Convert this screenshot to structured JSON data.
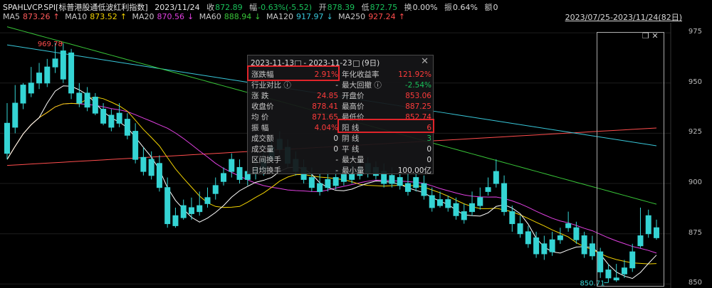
{
  "header": {
    "symbol": "SPAHLVCP.SPI[标普港股通低波红利指数]",
    "date": "2023/11/24",
    "close_label": "收",
    "close": "872.89",
    "pct_label": "幅",
    "pct": "-0.63%(-5.52)",
    "open_label": "开",
    "open": "878.39",
    "low_label": "低",
    "low": "872.75",
    "turnover_label": "换",
    "turnover": "0.00%",
    "amplitude_label": "振",
    "amplitude": "0.64%",
    "amount_label": "额",
    "amount": "0"
  },
  "ma": [
    {
      "name": "MA5",
      "value": "873.26",
      "arrow": "↑",
      "color": "#ffffff"
    },
    {
      "name": "MA10",
      "value": "873.52",
      "arrow": "↑",
      "color": "#f2d200"
    },
    {
      "name": "MA20",
      "value": "870.56",
      "arrow": "↓",
      "color": "#e040e0"
    },
    {
      "name": "MA60",
      "value": "888.94",
      "arrow": "↓",
      "color": "#38c538"
    },
    {
      "name": "MA120",
      "value": "917.97",
      "arrow": "↓",
      "color": "#38c6d8"
    },
    {
      "name": "MA250",
      "value": "927.24",
      "arrow": "↑",
      "color": "#ff4d4d"
    }
  ],
  "date_range": "2023/07/25-2023/11/24(82日)",
  "axis": {
    "ticks": [
      "975",
      "950",
      "925",
      "900",
      "875",
      "850"
    ],
    "high_label": "969.78",
    "low_label": "850.71"
  },
  "panel": {
    "start": "2023-11-13",
    "sep": "-",
    "end": "2023-11-23",
    "days": "(9日)",
    "close": "✕",
    "rows": [
      {
        "l1": "涨跌幅",
        "v1": "2.91%",
        "c1": "red",
        "l2": "年化收益率",
        "v2": "121.92%",
        "c2": "red"
      },
      {
        "l1": "行业对比 ⓘ",
        "v1": "-",
        "c1": "white",
        "l2": "最大回撤 ⓘ",
        "v2": "-2.54%",
        "c2": "green"
      },
      {
        "l1": "涨   跌",
        "v1": "24.85",
        "c1": "red",
        "l2": "开盘价",
        "v2": "853.06",
        "c2": "red"
      },
      {
        "l1": "收盘价",
        "v1": "878.41",
        "c1": "red",
        "l2": "最高价",
        "v2": "887.25",
        "c2": "red"
      },
      {
        "l1": "均   价",
        "v1": "871.65",
        "c1": "red",
        "l2": "最低价",
        "v2": "852.74",
        "c2": "red"
      },
      {
        "l1": "振   幅",
        "v1": "4.04%",
        "c1": "red",
        "l2": "阳   线",
        "v2": "6",
        "c2": "red"
      },
      {
        "l1": "成交额",
        "v1": "0",
        "c1": "white",
        "l2": "阴   线",
        "v2": "3",
        "c2": "green"
      },
      {
        "l1": "成交量",
        "v1": "0",
        "c1": "white",
        "l2": "平   线",
        "v2": "0",
        "c2": "white"
      },
      {
        "l1": "区间换手",
        "v1": "-",
        "c1": "white",
        "l2": "最大量",
        "v2": "0",
        "c2": "white"
      },
      {
        "l1": "日均换手",
        "v1": "-",
        "c1": "white",
        "l2": "最小量",
        "v2": "100.00亿",
        "c2": "white"
      }
    ]
  },
  "chart_data": {
    "type": "candlestick",
    "ylim": [
      848,
      980
    ],
    "candles": [
      [
        930,
        940,
        915,
        912
      ],
      [
        940,
        949,
        928,
        925
      ],
      [
        949,
        950,
        940,
        937
      ],
      [
        950,
        958,
        945,
        943
      ],
      [
        955,
        960,
        950,
        947
      ],
      [
        958,
        962,
        950,
        948
      ],
      [
        962,
        970,
        958,
        955
      ],
      [
        966,
        969.78,
        952,
        950
      ],
      [
        965,
        967,
        945,
        942
      ],
      [
        945,
        950,
        940,
        938
      ],
      [
        945,
        948,
        938,
        936
      ],
      [
        943,
        945,
        935,
        934
      ],
      [
        937,
        940,
        930,
        929
      ],
      [
        934,
        937,
        928,
        926
      ],
      [
        935,
        940,
        930,
        928
      ],
      [
        932,
        935,
        924,
        922
      ],
      [
        926,
        930,
        912,
        910
      ],
      [
        913,
        918,
        906,
        904
      ],
      [
        912,
        916,
        904,
        902
      ],
      [
        910,
        914,
        898,
        896
      ],
      [
        898,
        903,
        880,
        878
      ],
      [
        884,
        888,
        879,
        878
      ],
      [
        889,
        892,
        883,
        882
      ],
      [
        888,
        893,
        885,
        882
      ],
      [
        889,
        896,
        886,
        884
      ],
      [
        893,
        898,
        890,
        888
      ],
      [
        899,
        903,
        895,
        892
      ],
      [
        905,
        908,
        901,
        899
      ],
      [
        912,
        915,
        906,
        903
      ],
      [
        908,
        912,
        902,
        900
      ],
      [
        906,
        910,
        902,
        899
      ],
      [
        908,
        912,
        905,
        902
      ],
      [
        912,
        916,
        906,
        904
      ],
      [
        918,
        922,
        912,
        910
      ],
      [
        922,
        926,
        917,
        915
      ],
      [
        918,
        922,
        910,
        908
      ],
      [
        912,
        916,
        906,
        904
      ],
      [
        908,
        912,
        902,
        900
      ],
      [
        903,
        908,
        898,
        896
      ],
      [
        900,
        905,
        896,
        894
      ],
      [
        902,
        906,
        898,
        896
      ],
      [
        903,
        907,
        899,
        897
      ],
      [
        905,
        909,
        901,
        899
      ],
      [
        906,
        910,
        902,
        900
      ],
      [
        908,
        912,
        904,
        902
      ],
      [
        910,
        913,
        905,
        903
      ],
      [
        908,
        911,
        904,
        902
      ],
      [
        906,
        910,
        900,
        898
      ],
      [
        904,
        908,
        900,
        898
      ],
      [
        903,
        907,
        899,
        897
      ],
      [
        900,
        905,
        896,
        894
      ],
      [
        903,
        906,
        898,
        896
      ],
      [
        900,
        904,
        894,
        892
      ],
      [
        894,
        898,
        888,
        886
      ],
      [
        892,
        896,
        889,
        888
      ],
      [
        892,
        894,
        888,
        886
      ],
      [
        890,
        893,
        884,
        882
      ],
      [
        886,
        890,
        882,
        880
      ],
      [
        890,
        896,
        886,
        884
      ],
      [
        893,
        898,
        889,
        887
      ],
      [
        898,
        903,
        896,
        894
      ],
      [
        906,
        912,
        900,
        898
      ],
      [
        900,
        904,
        886,
        884
      ],
      [
        886,
        889,
        880,
        876
      ],
      [
        880,
        884,
        875,
        873
      ],
      [
        876,
        879,
        870,
        868
      ],
      [
        873,
        876,
        865,
        863
      ],
      [
        870,
        874,
        865,
        862
      ],
      [
        872,
        876,
        866,
        864
      ],
      [
        874,
        878,
        872,
        870
      ],
      [
        880,
        886,
        878,
        876
      ],
      [
        878,
        881,
        872,
        870
      ],
      [
        874,
        876,
        865,
        863
      ],
      [
        870,
        874,
        864,
        862
      ],
      [
        866,
        868,
        856,
        853
      ],
      [
        857,
        860,
        853,
        850.71
      ],
      [
        853,
        860,
        852,
        851
      ],
      [
        858,
        862,
        855,
        853
      ],
      [
        866,
        870,
        858,
        856
      ],
      [
        874,
        888,
        869,
        868
      ],
      [
        884,
        887,
        875,
        873
      ],
      [
        878,
        882,
        873,
        872
      ]
    ]
  }
}
